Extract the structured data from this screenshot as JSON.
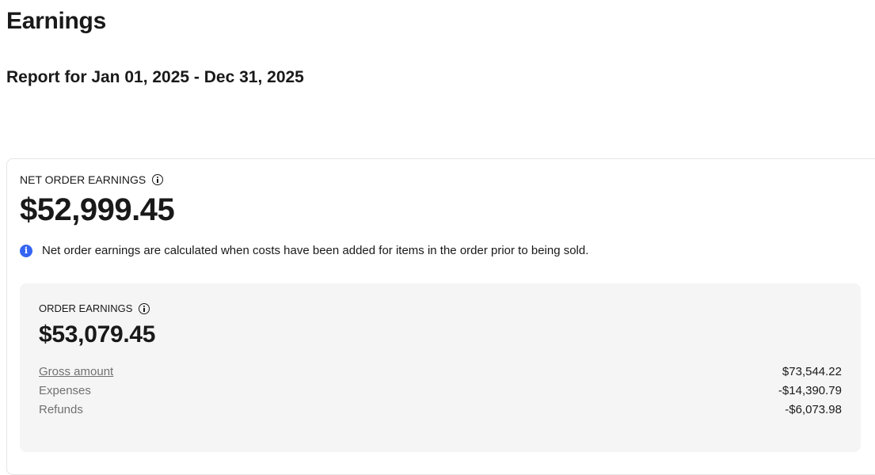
{
  "page": {
    "title": "Earnings",
    "report_range": "Report for Jan 01, 2025 - Dec 31, 2025"
  },
  "net_order_earnings": {
    "label": "NET ORDER EARNINGS",
    "amount": "$52,999.45",
    "notice": "Net order earnings are calculated when costs have been added for items in the order prior to being sold.",
    "info_icon": "info-outline-icon",
    "notice_icon": "info-filled-icon"
  },
  "order_earnings": {
    "label": "ORDER EARNINGS",
    "amount": "$53,079.45",
    "info_icon": "info-outline-icon",
    "items": [
      {
        "label": "Gross amount",
        "value": "$73,544.22"
      },
      {
        "label": "Expenses",
        "value": "-$14,390.79"
      },
      {
        "label": "Refunds",
        "value": "-$6,073.98"
      }
    ]
  },
  "colors": {
    "accent": "#3665f3",
    "panel_bg": "#f5f5f5",
    "muted_text": "#707070"
  }
}
